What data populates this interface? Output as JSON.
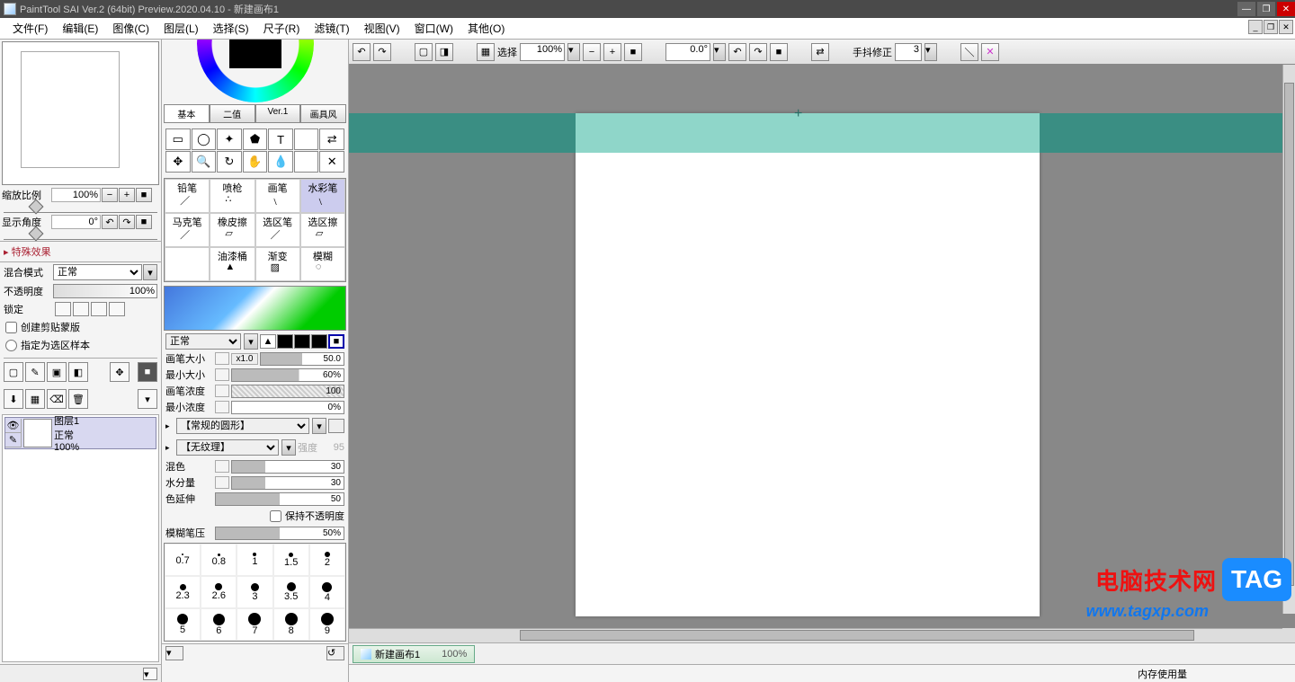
{
  "title": "PaintTool SAI Ver.2 (64bit) Preview.2020.04.10 - 新建画布1",
  "menus": [
    "文件(F)",
    "编辑(E)",
    "图像(C)",
    "图层(L)",
    "选择(S)",
    "尺子(R)",
    "滤镜(T)",
    "视图(V)",
    "窗口(W)",
    "其他(O)"
  ],
  "navigator": {
    "zoom_label": "缩放比例",
    "zoom_value": "100%",
    "angle_label": "显示角度",
    "angle_value": "0°",
    "effects_header": "特殊效果"
  },
  "layer_panel": {
    "blend_label": "混合模式",
    "blend_value": "正常",
    "opacity_label": "不透明度",
    "opacity_value": "100%",
    "lock_label": "锁定",
    "clip_mask": "创建剪贴蒙版",
    "select_source": "指定为选区样本",
    "layer": {
      "name": "图层1",
      "mode": "正常",
      "opacity": "100%"
    }
  },
  "tool_tabs": [
    "基本",
    "二值",
    "Ver.1",
    "画具风"
  ],
  "brushes": [
    "铅笔",
    "喷枪",
    "画笔",
    "水彩笔",
    "马克笔",
    "橡皮擦",
    "选区笔",
    "选区擦",
    "",
    "油漆桶",
    "渐变",
    "模糊"
  ],
  "brush_mode": "正常",
  "params": {
    "size_label": "画笔大小",
    "size_x": "x1.0",
    "size_val": "50.0",
    "min_size_label": "最小大小",
    "min_size_val": "60%",
    "density_label": "画笔浓度",
    "density_val": "100",
    "min_density_label": "最小浓度",
    "min_density_val": "0%",
    "shape": "【常规的圆形】",
    "texture": "【无纹理】",
    "texture_str_label": "强度",
    "texture_str": "95",
    "mix_label": "混色",
    "mix_val": "30",
    "water_label": "水分量",
    "water_val": "30",
    "extend_label": "色延伸",
    "extend_val": "50",
    "keep_opacity": "保持不透明度",
    "blur_label": "模糊笔压",
    "blur_val": "50%"
  },
  "sizes": [
    "0.7",
    "0.8",
    "1",
    "1.5",
    "2",
    "2.3",
    "2.6",
    "3",
    "3.5",
    "4",
    "5",
    "6",
    "7",
    "8",
    "9"
  ],
  "canvas_toolbar": {
    "select_label": "选择",
    "zoom": "100%",
    "angle": "0.0°",
    "stabilizer_label": "手抖修正",
    "stabilizer_value": "3"
  },
  "doc_tab": {
    "name": "新建画布1",
    "zoom": "100%"
  },
  "status": {
    "memory_label": "内存使用量"
  },
  "watermark": {
    "site": "电脑技术网",
    "url": "www.tagxp.com",
    "tag": "TAG"
  }
}
